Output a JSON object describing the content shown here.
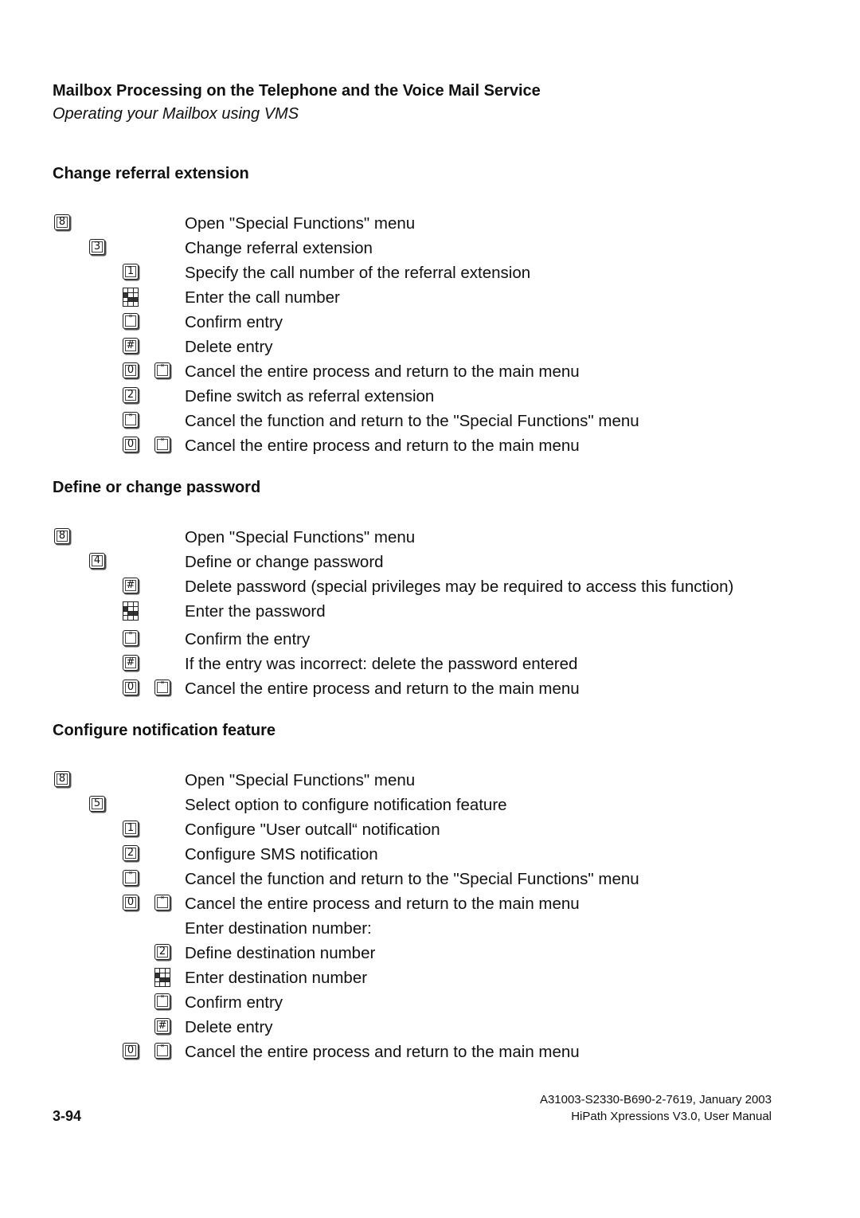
{
  "header": {
    "title": "Mailbox Processing on the Telephone and the Voice Mail Service",
    "subtitle": "Operating your Mailbox using VMS"
  },
  "sections": [
    {
      "title": "Change referral extension",
      "rows": [
        {
          "keys": [
            "8"
          ],
          "text": "Open \"Special Functions\" menu"
        },
        {
          "keys": [
            "3"
          ],
          "text": "Change referral extension"
        },
        {
          "keys": [
            "1"
          ],
          "text": "Specify the call number of the referral extension"
        },
        {
          "keys": [
            "keypad"
          ],
          "text": "Enter the call number"
        },
        {
          "keys": [
            "*"
          ],
          "text": "Confirm entry"
        },
        {
          "keys": [
            "#"
          ],
          "text": "Delete entry"
        },
        {
          "keys": [
            "0",
            "*"
          ],
          "text": "Cancel the entire process and return to the main menu"
        },
        {
          "keys": [
            "2"
          ],
          "text": "Define switch as referral extension"
        },
        {
          "keys": [
            "*"
          ],
          "text": "Cancel the function and return to the \"Special Functions\" menu"
        },
        {
          "keys": [
            "0",
            "*"
          ],
          "text": "Cancel the entire process and return to the main menu"
        }
      ]
    },
    {
      "title": "Define or change password",
      "rows": [
        {
          "keys": [
            "8"
          ],
          "text": "Open \"Special Functions\" menu"
        },
        {
          "keys": [
            "4"
          ],
          "text": "Define or change password"
        },
        {
          "keys": [
            "#"
          ],
          "text": "Delete password (special privileges may be required to access this function)"
        },
        {
          "keys": [
            "keypad"
          ],
          "text": "Enter the password"
        },
        {
          "keys": [
            "*"
          ],
          "text": "Confirm the entry"
        },
        {
          "keys": [
            "#"
          ],
          "text": "If the entry was incorrect: delete the password entered"
        },
        {
          "keys": [
            "0",
            "*"
          ],
          "text": "Cancel the entire process and return to the main menu"
        }
      ]
    },
    {
      "title": "Configure notification feature",
      "rows": [
        {
          "keys": [
            "8"
          ],
          "text": "Open \"Special Functions\" menu"
        },
        {
          "keys": [
            "5"
          ],
          "text": "Select option to configure notification feature"
        },
        {
          "keys": [
            "1"
          ],
          "text": "Configure \"User outcall“ notification"
        },
        {
          "keys": [
            "2"
          ],
          "text": "Configure SMS notification"
        },
        {
          "keys": [
            "*"
          ],
          "text": "Cancel the function and return to the \"Special Functions\" menu"
        },
        {
          "keys": [
            "0",
            "*"
          ],
          "text": "Cancel the entire process and return to the main menu"
        },
        {
          "keys": [],
          "text": "Enter destination number:"
        },
        {
          "keys": [
            "2"
          ],
          "text": "Define destination number"
        },
        {
          "keys": [
            "keypad"
          ],
          "text": "Enter destination number"
        },
        {
          "keys": [
            "*"
          ],
          "text": "Confirm entry"
        },
        {
          "keys": [
            "#"
          ],
          "text": "Delete entry"
        },
        {
          "keys": [
            "0",
            "*"
          ],
          "text": "Cancel the entire process and return to the main menu"
        }
      ]
    }
  ],
  "footer": {
    "doc_code": "A31003-S2330-B690-2-7619, January 2003",
    "manual": "HiPath Xpressions V3.0, User Manual",
    "page_number": "3-94"
  }
}
